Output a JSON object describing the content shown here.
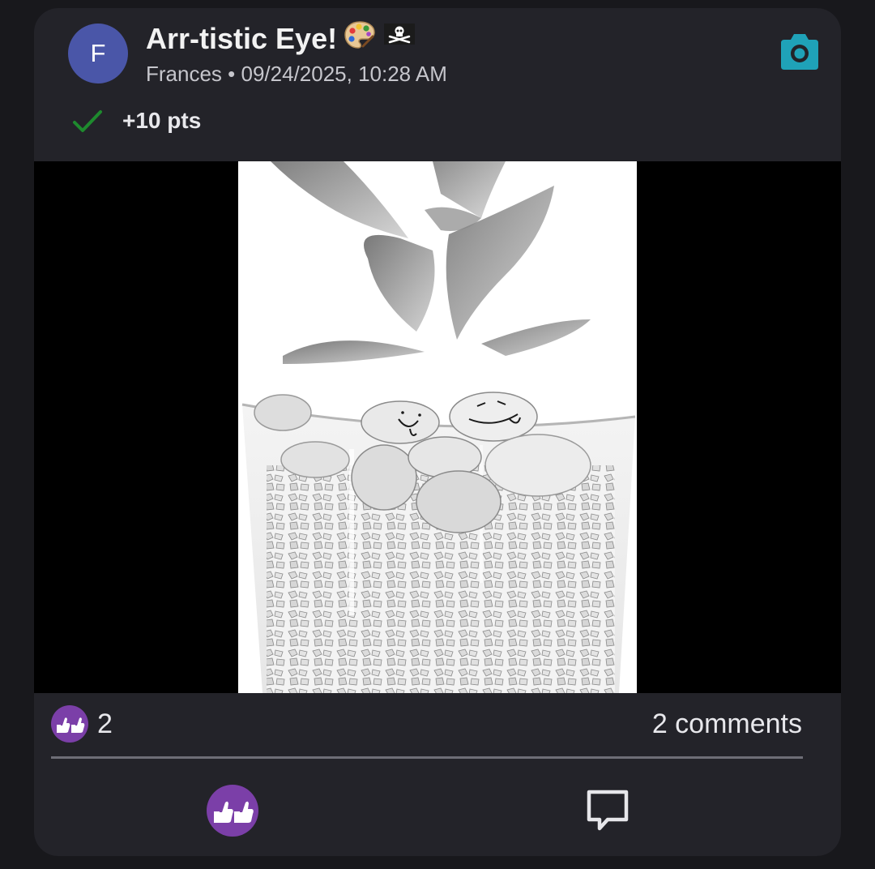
{
  "post": {
    "avatar_initial": "F",
    "title": "Arr-tistic Eye!",
    "title_emojis": [
      "palette-emoji",
      "pirate-flag-emoji"
    ],
    "author": "Frances",
    "separator": "•",
    "timestamp": "09/24/2025, 10:28 AM",
    "badge_icon": "camera-icon",
    "points_label": "+10 pts",
    "points_status_icon": "checkmark-icon",
    "image": {
      "description_icon": "photo-plant-pebbles",
      "grayscale": true
    }
  },
  "stats": {
    "reaction_icon": "thumbs-up-reaction-icon",
    "reaction_count": "2",
    "comments_label": "2 comments"
  },
  "actions": {
    "like_icon": "thumbs-up-reaction-icon",
    "comment_icon": "comment-bubble-icon"
  },
  "colors": {
    "background": "#18181c",
    "card": "#232329",
    "avatar": "#4a56a8",
    "accent_camera": "#1fa2b8",
    "check_green": "#1e8a2e",
    "reaction_purple": "#7b3fa8"
  }
}
